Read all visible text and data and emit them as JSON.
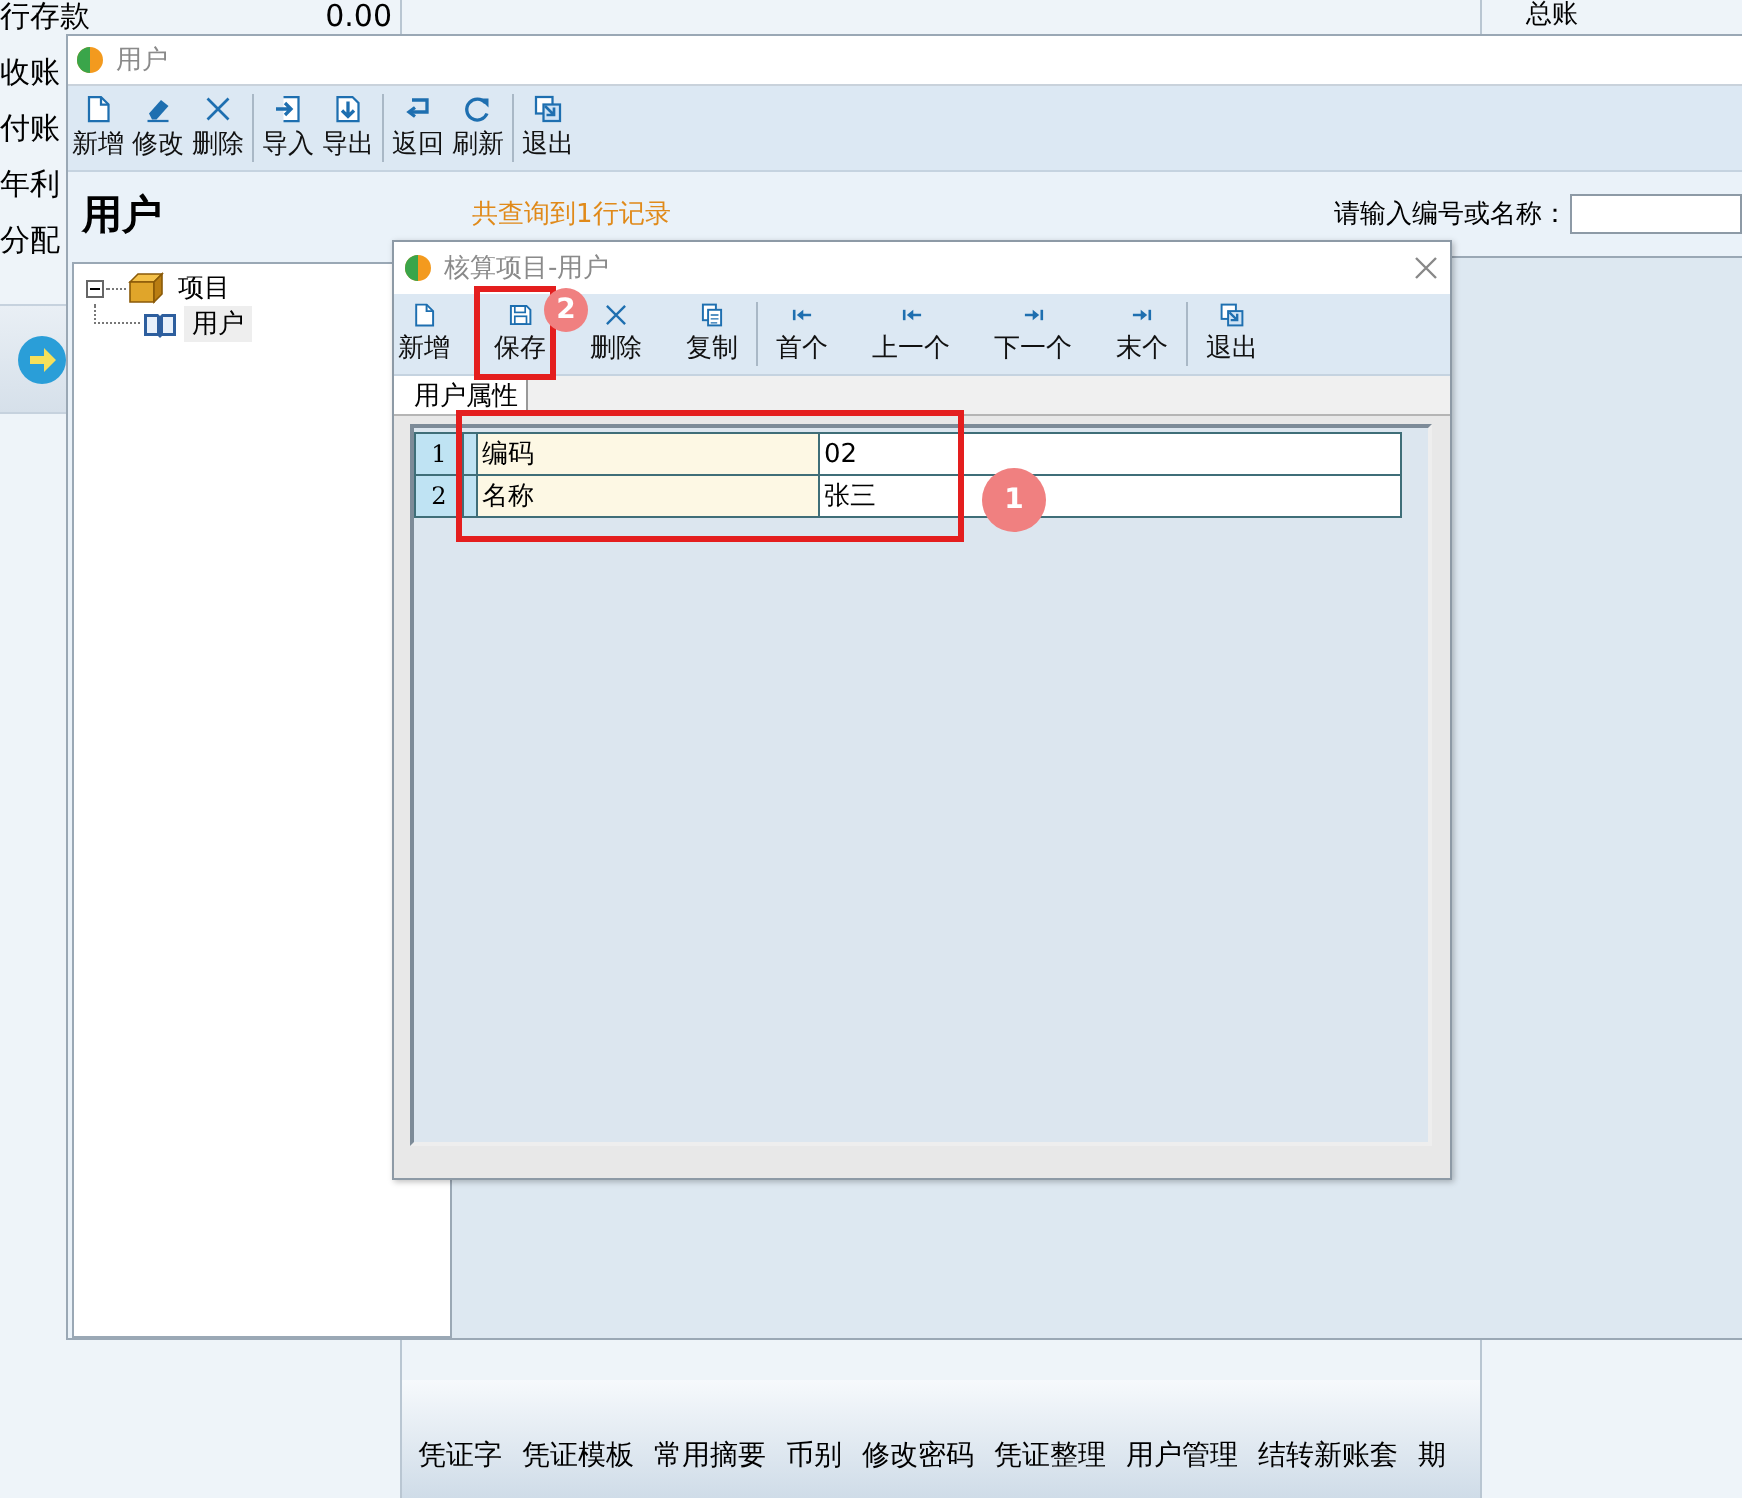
{
  "background": {
    "left_items": [
      {
        "label": "行存款",
        "value": "0.00"
      },
      {
        "label": "收账"
      },
      {
        "label": "付账"
      },
      {
        "label": "年利"
      },
      {
        "label": "分配"
      }
    ],
    "top_right_label": "总账",
    "bottom_menu": [
      "凭证字",
      "凭证模板",
      "常用摘要",
      "币别",
      "修改密码",
      "凭证整理",
      "用户管理",
      "结转新账套",
      "期"
    ]
  },
  "user_window": {
    "title": "用户",
    "toolbar": [
      [
        {
          "label": "新增",
          "kind": "new"
        },
        {
          "label": "修改",
          "kind": "edit"
        },
        {
          "label": "删除",
          "kind": "delete"
        }
      ],
      [
        {
          "label": "导入",
          "kind": "import"
        },
        {
          "label": "导出",
          "kind": "export"
        }
      ],
      [
        {
          "label": "返回",
          "kind": "back"
        },
        {
          "label": "刷新",
          "kind": "refresh"
        }
      ],
      [
        {
          "label": "退出",
          "kind": "exit"
        }
      ]
    ],
    "heading": "用户",
    "record_count": "共查询到1行记录",
    "search": {
      "label": "请输入编号或名称："
    },
    "tree": [
      {
        "label": "项目",
        "expanded": true,
        "selected": false,
        "children": [
          {
            "label": "用户",
            "selected": true
          }
        ]
      }
    ]
  },
  "dialog": {
    "title": "核算项目-用户",
    "toolbar": [
      [
        {
          "label": "新增",
          "kind": "new"
        },
        {
          "label": "保存",
          "kind": "save"
        },
        {
          "label": "删除",
          "kind": "delete"
        },
        {
          "label": "复制",
          "kind": "copy"
        }
      ],
      [
        {
          "label": "首个",
          "kind": "first"
        },
        {
          "label": "上一个",
          "kind": "prev"
        },
        {
          "label": "下一个",
          "kind": "next"
        },
        {
          "label": "末个",
          "kind": "last"
        }
      ],
      [
        {
          "label": "退出",
          "kind": "exit"
        }
      ]
    ],
    "tabs": [
      {
        "label": "用户属性",
        "selected": true
      }
    ],
    "rows": [
      {
        "number": "1",
        "name": "编码",
        "value": "02"
      },
      {
        "number": "2",
        "name": "名称",
        "value": "张三"
      }
    ]
  },
  "annotations": [
    {
      "kind": "box"
    },
    {
      "kind": "box"
    },
    {
      "kind": "badge",
      "label": "1"
    },
    {
      "kind": "badge",
      "label": "2"
    }
  ]
}
